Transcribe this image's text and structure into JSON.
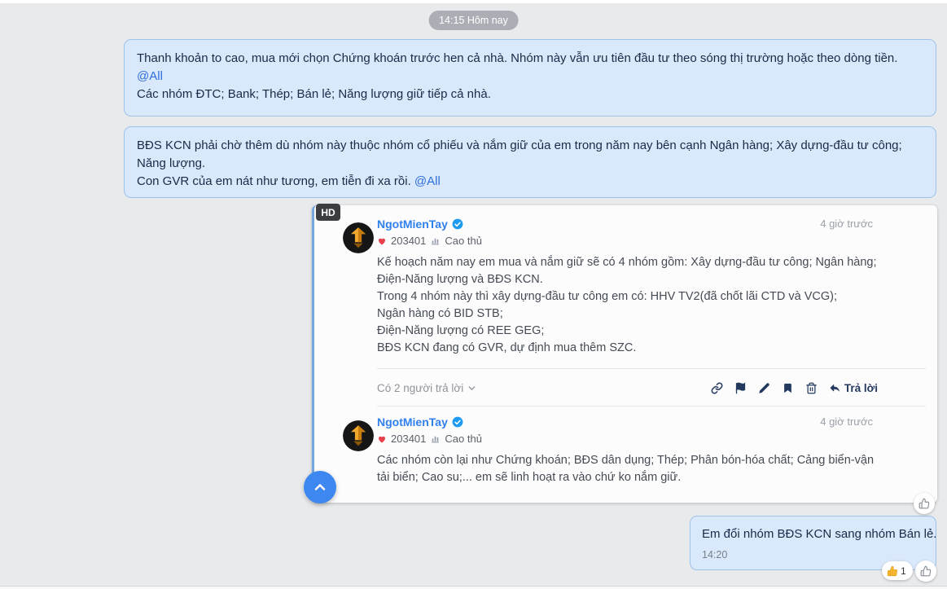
{
  "timestamp_pill": "14:15 Hôm nay",
  "incoming_messages": [
    {
      "p1": "Thanh khoản to cao, mua mới chọn Chứng khoán trước hen cả nhà. Nhóm này vẫn ưu tiên đầu tư theo sóng thị trường hoặc theo dòng tiền.",
      "mention": "@All",
      "p2": "Các nhóm ĐTC; Bank; Thép; Bán lẻ; Năng lượng giữ tiếp cả nhà."
    },
    {
      "p1": "BĐS KCN phải chờ thêm dù nhóm này thuộc nhóm cổ phiếu và nắm giữ của em trong năm nay bên cạnh Ngân hàng; Xây dựng-đầu tư công; Năng lượng.",
      "p2": "Con GVR của em nát như tương, em tiễn đi xa rồi.",
      "mention": "@All"
    }
  ],
  "quote_card": {
    "hd_badge": "HD",
    "replies_toggle": "Có 2 người trả lời",
    "reply_action_label": "Trả lời",
    "posts": [
      {
        "username": "NgotMienTay",
        "likes": "203401",
        "rank": "Cao thủ",
        "time": "4 giờ trước",
        "body": [
          "Kế hoạch năm nay em mua và nắm giữ sẽ có 4 nhóm gồm: Xây dựng-đầu tư công; Ngân hàng; Điện-Năng lượng và BĐS KCN.",
          "Trong 4 nhóm này thì xây dựng-đầu tư công em có: HHV TV2(đã chốt lãi CTD và VCG);",
          "Ngân hàng có BID STB;",
          "Điện-Năng lượng có REE GEG;",
          "BĐS KCN đang có GVR, dự định mua thêm SZC."
        ]
      },
      {
        "username": "NgotMienTay",
        "likes": "203401",
        "rank": "Cao thủ",
        "time": "4 giờ trước",
        "body": [
          "Các nhóm còn lại như Chứng khoán; BĐS dân dụng; Thép; Phân bón-hóa chất; Cảng biển-vận tải biển; Cao su;... em sẽ linh hoạt ra vào chứ ko nắm giữ."
        ]
      }
    ]
  },
  "outgoing_message": {
    "text": "Em đổi nhóm BĐS KCN sang nhóm Bán lẻ.",
    "time": "14:20",
    "reaction_count": "1"
  },
  "icons": {
    "link": "chain-link",
    "flag": "report-flag",
    "edit": "pencil",
    "bookmark": "bookmark",
    "delete": "trash",
    "reply": "reply-arrow",
    "collapse": "chevron-down",
    "scroll_up": "chevron-up",
    "verified": "check-badge",
    "heart": "heart",
    "rank": "trend-chart",
    "like": "thumbs-up"
  },
  "colors": {
    "page_bg": "#e9eaec",
    "bubble_bg": "#d9e8fa",
    "bubble_border": "#9dc3ec",
    "bubble_text": "#1b2a47",
    "link_blue": "#2e6fdb",
    "username_blue": "#2f80ed",
    "verified_blue": "#1d9bf0",
    "heart_red": "#e8404d",
    "icon_navy": "#24395e",
    "accent_blue": "#3c87f0",
    "reaction_yellow": "#f5b52e"
  }
}
